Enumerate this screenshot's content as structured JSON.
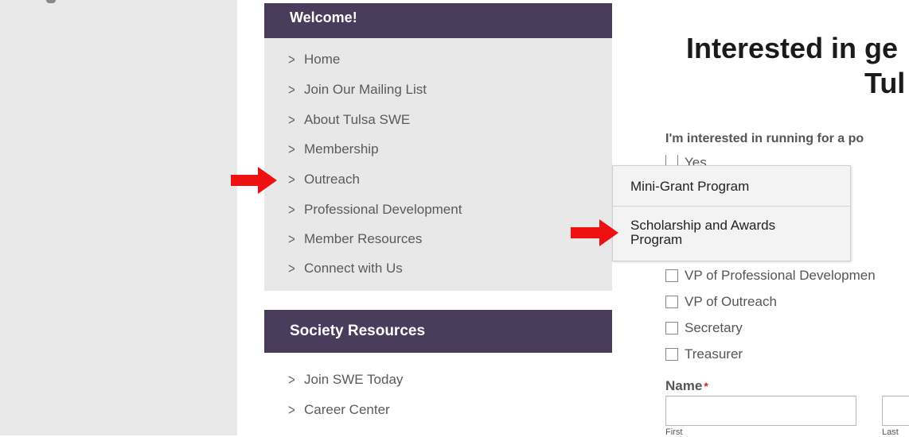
{
  "sidebar": {
    "welcome_header": "Welcome!",
    "menu_items": [
      {
        "label": "Home"
      },
      {
        "label": "Join Our Mailing List"
      },
      {
        "label": "About Tulsa SWE"
      },
      {
        "label": "Membership"
      },
      {
        "label": "Outreach"
      },
      {
        "label": "Professional Development"
      },
      {
        "label": "Member Resources"
      },
      {
        "label": "Connect with Us"
      }
    ],
    "resources_header": "Society Resources",
    "resource_items": [
      {
        "label": "Join SWE Today"
      },
      {
        "label": "Career Center"
      }
    ]
  },
  "submenu": {
    "items": [
      {
        "label": "Mini-Grant Program"
      },
      {
        "label": "Scholarship and Awards Program"
      }
    ]
  },
  "main": {
    "title_line1": "Interested in ge",
    "title_line2": "Tul",
    "question": "I'm interested in running for a po",
    "checkbox_partial": "Yes",
    "checkboxes": [
      {
        "label": "VP of Professional Developmen"
      },
      {
        "label": "VP of Outreach"
      },
      {
        "label": "Secretary"
      },
      {
        "label": "Treasurer"
      }
    ],
    "name_label": "Name",
    "required_mark": "*",
    "first_sublabel": "First",
    "last_sublabel": "Last"
  },
  "colors": {
    "header_bg": "#4a3d5c",
    "menu_bg": "#e8e8e8",
    "arrow": "#ee1111"
  }
}
